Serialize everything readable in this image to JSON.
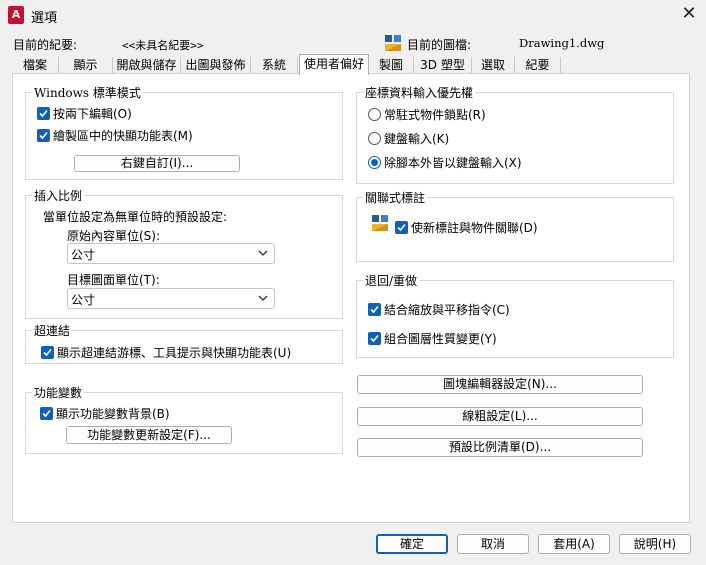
{
  "window": {
    "title": "選項",
    "app_icon": "A",
    "close_glyph": "✕"
  },
  "header": {
    "profile_label": "目前的紀要:",
    "profile_value": "<<未具名紀要>>",
    "drawing_label": "目前的圖檔:",
    "drawing_value": "Drawing1.dwg"
  },
  "tabs": [
    {
      "label": "檔案"
    },
    {
      "label": "顯示"
    },
    {
      "label": "開啟與儲存"
    },
    {
      "label": "出圖與發佈"
    },
    {
      "label": "系統"
    },
    {
      "label": "使用者偏好",
      "active": true
    },
    {
      "label": "製圖"
    },
    {
      "label": "3D 塑型"
    },
    {
      "label": "選取"
    },
    {
      "label": "紀要"
    }
  ],
  "windows_style": {
    "title": "Windows 標準模式",
    "double_click_edit": {
      "label": "按兩下編輯(O)",
      "checked": true
    },
    "shortcut_menus": {
      "label": "繪製區中的快顯功能表(M)",
      "checked": true
    },
    "right_click_button": "右鍵自訂(I)..."
  },
  "insertion_scale": {
    "title": "插入比例",
    "description": "當單位設定為無單位時的預設設定:",
    "source_label": "原始內容單位(S):",
    "source_value": "公寸",
    "target_label": "目標圖面單位(T):",
    "target_value": "公寸"
  },
  "hyperlink": {
    "title": "超連結",
    "show_cursor": {
      "label": "顯示超連結游標、工具提示與快顯功能表(U)",
      "checked": true
    }
  },
  "fields": {
    "title": "功能變數",
    "show_background": {
      "label": "顯示功能變數背景(B)",
      "checked": true
    },
    "update_button": "功能變數更新設定(F)..."
  },
  "coord_priority": {
    "title": "座標資料輸入優先權",
    "options": [
      {
        "label": "常駐式物件鎖點(R)",
        "selected": false
      },
      {
        "label": "鍵盤輸入(K)",
        "selected": false
      },
      {
        "label": "除腳本外皆以鍵盤輸入(X)",
        "selected": true
      }
    ]
  },
  "assoc_dim": {
    "title": "關聯式標註",
    "make_assoc": {
      "label": "使新標註與物件關聯(D)",
      "checked": true
    }
  },
  "undo_redo": {
    "title": "退回/重做",
    "combine_zoom": {
      "label": "結合縮放與平移指令(C)",
      "checked": true
    },
    "combine_layer": {
      "label": "組合圖層性質變更(Y)",
      "checked": true
    }
  },
  "right_buttons": {
    "block_editor": "圖塊編輯器設定(N)...",
    "lineweight": "線粗設定(L)...",
    "scale_list": "預設比例清單(D)..."
  },
  "footer": {
    "ok": "確定",
    "cancel": "取消",
    "apply": "套用(A)",
    "help": "說明(H)"
  },
  "colors": {
    "accent": "#0f5fbd",
    "app_icon": "#c8102e"
  },
  "icons": [
    "autocad-app-icon",
    "close-icon",
    "drawing-file-icon",
    "associative-dimension-icon",
    "checkbox-checked-icon",
    "chevron-down-icon"
  ]
}
